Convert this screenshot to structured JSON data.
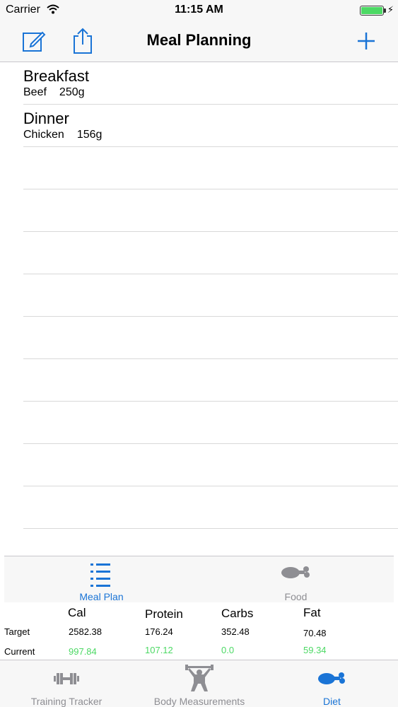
{
  "status_bar": {
    "carrier": "Carrier",
    "time": "11:15 AM"
  },
  "navbar": {
    "title": "Meal Planning",
    "icons": [
      "compose-icon",
      "share-icon",
      "add-icon"
    ]
  },
  "meals": [
    {
      "title": "Breakfast",
      "food": "Beef",
      "amount": "250g"
    },
    {
      "title": "Dinner",
      "food": "Chicken",
      "amount": "156g"
    }
  ],
  "segment": {
    "meal_plan": "Meal Plan",
    "food": "Food"
  },
  "summary": {
    "headers": {
      "cal": "Cal",
      "protein": "Protein",
      "carbs": "Carbs",
      "fat": "Fat"
    },
    "target": {
      "label": "Target",
      "cal": "2582.38",
      "protein": "176.24",
      "carbs": "352.48",
      "fat": "70.48"
    },
    "current": {
      "label": "Current",
      "cal": "997.84",
      "protein": "107.12",
      "carbs": "0.0",
      "fat": "59.34"
    }
  },
  "tabbar": {
    "training": "Training Tracker",
    "body": "Body Measurements",
    "diet": "Diet"
  },
  "colors": {
    "accent": "#1a74d6",
    "current_values": "#4cd964",
    "inactive": "#8e8e93"
  }
}
